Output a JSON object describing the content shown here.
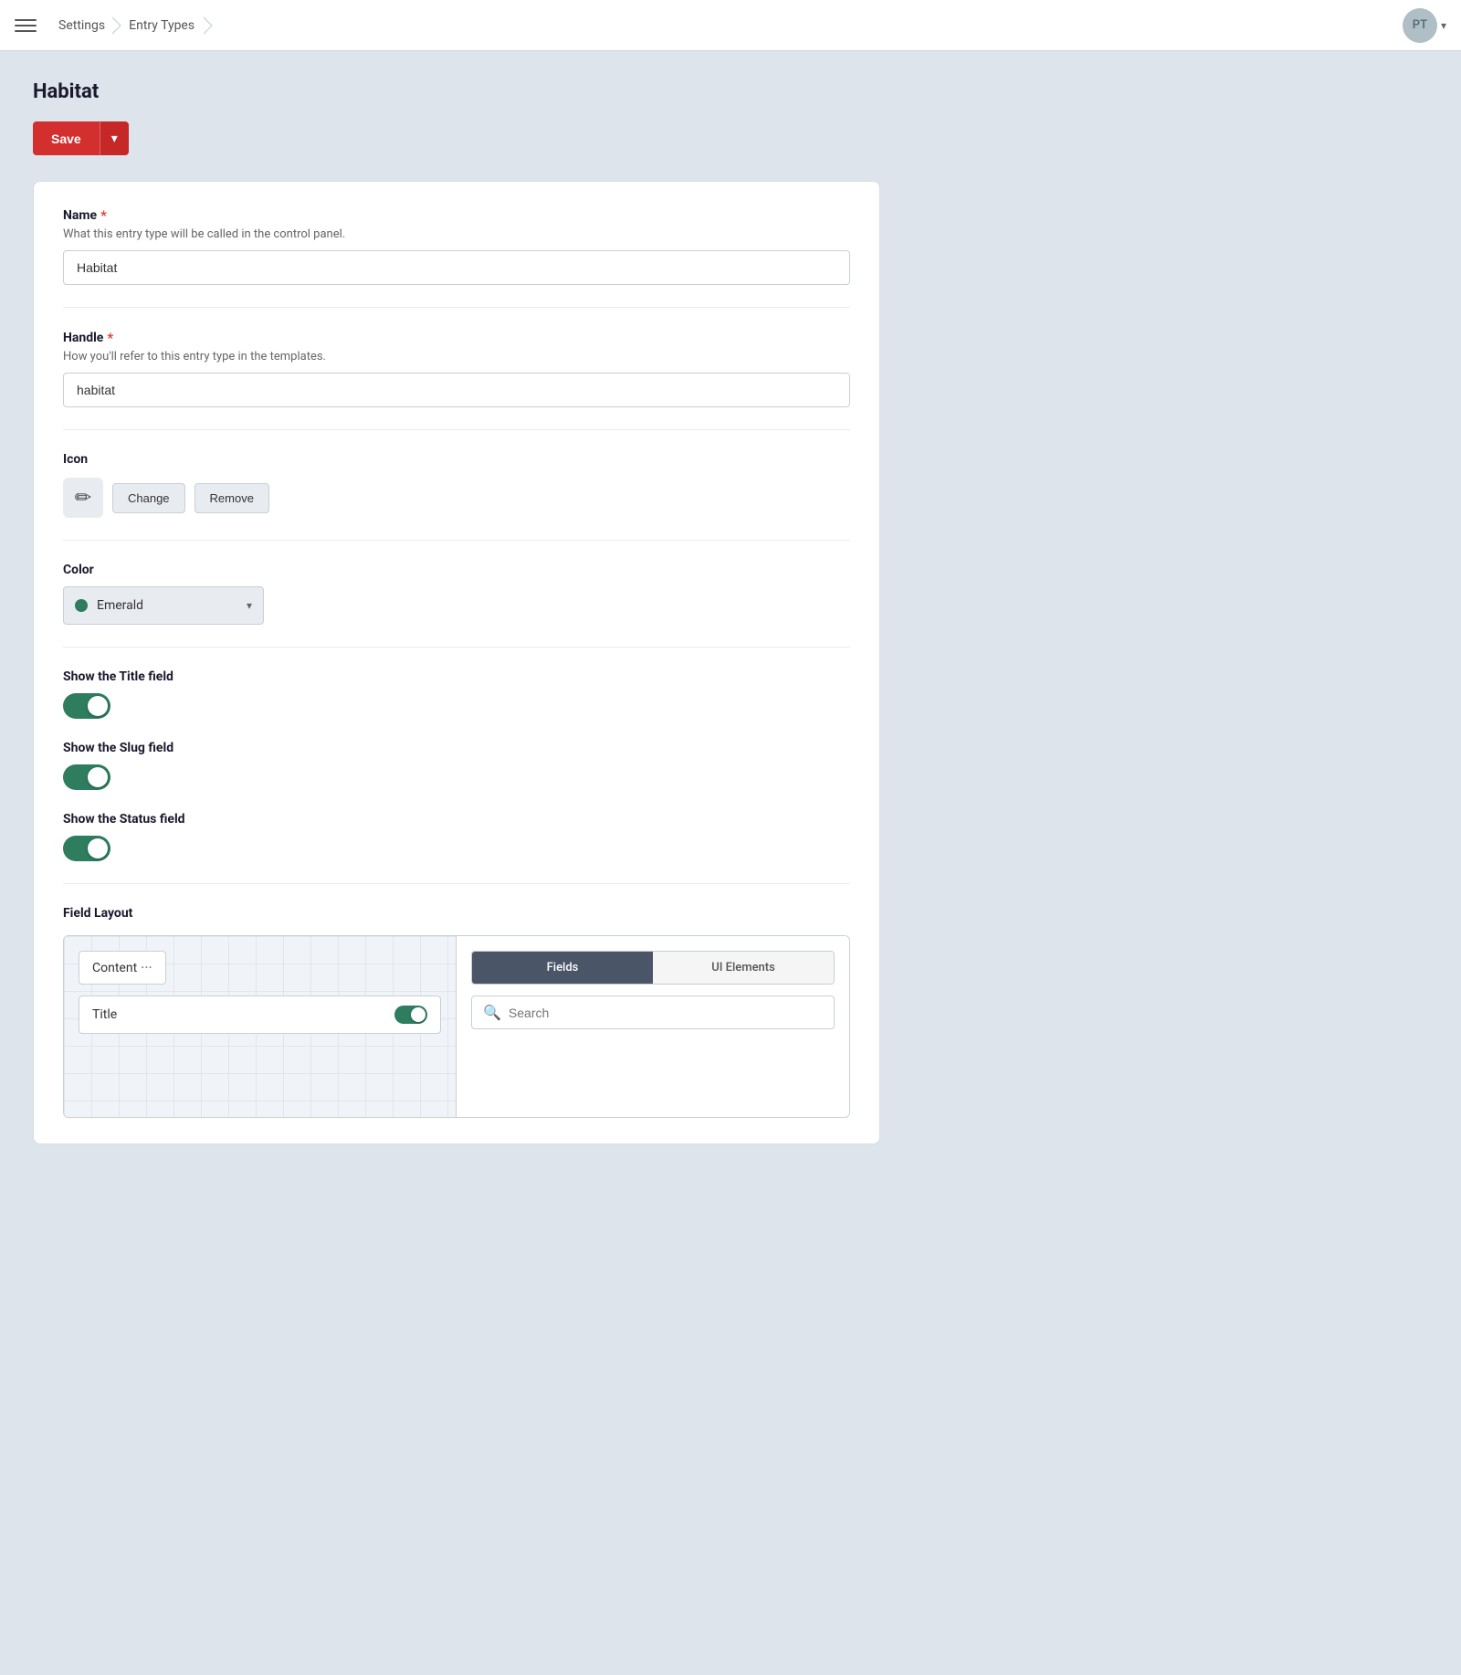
{
  "topbar": {
    "breadcrumb_settings": "Settings",
    "breadcrumb_entry_types": "Entry Types"
  },
  "user": {
    "initials": "PT"
  },
  "page": {
    "title": "Habitat"
  },
  "toolbar": {
    "save_label": "Save"
  },
  "form": {
    "name_label": "Name",
    "name_description": "What this entry type will be called in the control panel.",
    "name_value": "Habitat",
    "handle_label": "Handle",
    "handle_description": "How you'll refer to this entry type in the templates.",
    "handle_value": "habitat",
    "icon_label": "Icon",
    "icon_symbol": "✏",
    "icon_change_btn": "Change",
    "icon_remove_btn": "Remove",
    "color_label": "Color",
    "color_value": "Emerald",
    "show_title_label": "Show the Title field",
    "show_slug_label": "Show the Slug field",
    "show_status_label": "Show the Status field",
    "field_layout_label": "Field Layout",
    "content_tab_label": "Content",
    "title_field_label": "Title",
    "fields_tab": "Fields",
    "ui_elements_tab": "UI Elements",
    "search_placeholder": "Search"
  }
}
